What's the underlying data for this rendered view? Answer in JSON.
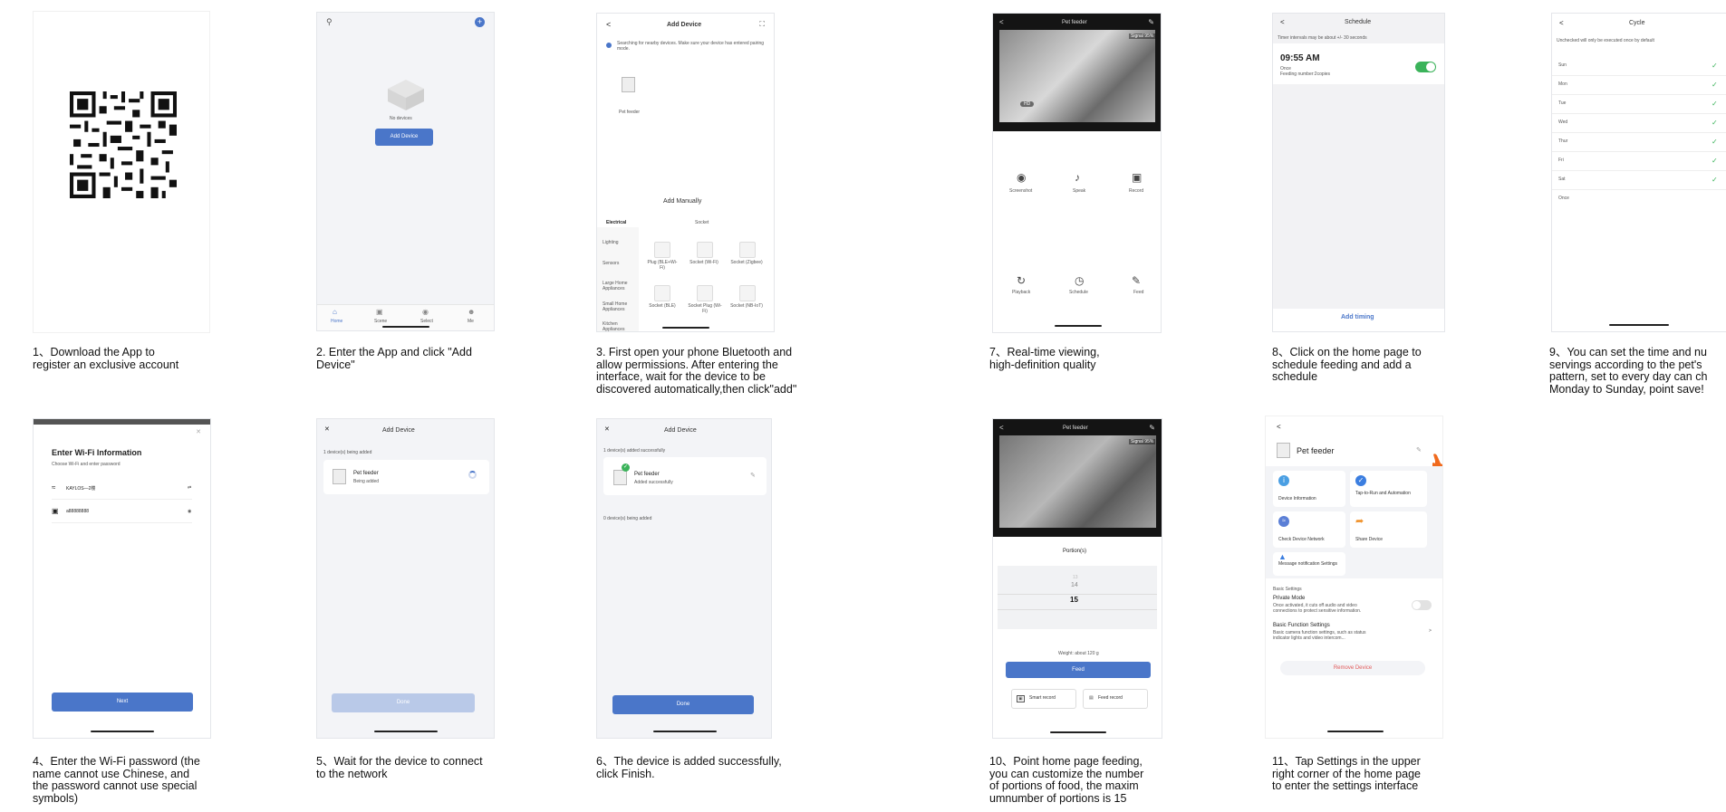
{
  "captions": {
    "c1": [
      "1、Download the App to",
      "register an exclusive account"
    ],
    "c2": [
      "2. Enter the App and click \"Add",
      "Device\""
    ],
    "c3": [
      "3. First open your phone Bluetooth and",
      "allow permissions. After entering the",
      "interface, wait for the device to be",
      "discovered automatically,then click\"add\""
    ],
    "c7": [
      "7、Real-time viewing,",
      "high-definition quality"
    ],
    "c8": [
      "8、Click on the home page to",
      "schedule feeding and add a",
      "schedule"
    ],
    "c9": [
      "9、You can set the time and nu",
      "servings according to the pet's",
      "pattern, set to every day can ch",
      "Monday to Sunday, point save!"
    ],
    "c4": [
      "4、Enter the Wi-Fi password (the",
      "name cannot use Chinese, and",
      "the password cannot use special",
      "symbols)"
    ],
    "c5": [
      "5、Wait for the device to connect",
      "to the network"
    ],
    "c6": [
      "6、The device is added successfully,",
      "click Finish."
    ],
    "c10": [
      "10、Point home page feeding,",
      "you can customize the number",
      "of portions of food, the maxim",
      "umnumber of portions is 15"
    ],
    "c11": [
      "11、Tap Settings in the upper",
      "right corner of the home page",
      "to enter the settings interface"
    ]
  },
  "s2": {
    "empty": "No devices",
    "add_button": "Add Device",
    "tabs": [
      "Home",
      "Scene",
      "Select",
      "Me"
    ]
  },
  "s3": {
    "title": "Add Device",
    "scan_text": "Searching for nearby devices. Make sure your device has entered pairing mode.",
    "found_device": "Pet feeder",
    "add_manually": "Add Manually",
    "tabs": [
      "Electrical",
      "Socket"
    ],
    "categories": [
      "Lighting",
      "Sensors",
      "Large Home Appliances",
      "Small Home Appliances",
      "Kitchen Appliances"
    ],
    "items": [
      "Plug (BLE+Wi-Fi)",
      "Socket (Wi-Fi)",
      "Socket (Zigbee)",
      "Socket (BLE)",
      "Socket Plug (Wi-Fi)",
      "Socket (NB-IoT)"
    ]
  },
  "s7": {
    "title": "Pet feeder",
    "badge": "Signal 95%",
    "hd": "HD",
    "controls": [
      "Screenshot",
      "Speak",
      "Record",
      "Playback",
      "Schedule",
      "Feed"
    ]
  },
  "s8": {
    "title": "Schedule",
    "note": "Timer intervals may be about +/- 30 seconds",
    "time": "09:55 AM",
    "sub1": "Once",
    "sub2": "Feeding number:2copies",
    "add_timing": "Add timing"
  },
  "s9": {
    "title": "Cycle",
    "note": "Unchecked will only be executed once by default",
    "days": [
      "Sun",
      "Mon",
      "Tue",
      "Wed",
      "Thur",
      "Fri",
      "Sat",
      "Once"
    ]
  },
  "s4": {
    "title": "Enter Wi-Fi Information",
    "subtitle": "Choose Wi-Fi and enter password",
    "ssid": "KAYLOS—2楼",
    "password": "a88888888",
    "next": "Next"
  },
  "s5": {
    "title": "Add Device",
    "status": "1 device(s) being added",
    "device": "Pet feeder",
    "device_status": "Being added",
    "done": "Done"
  },
  "s6": {
    "title": "Add Device",
    "status": "1 device(s) added successfully",
    "device": "Pet feeder",
    "device_status": "Added successfully",
    "pending": "0 device(s) being added",
    "done": "Done"
  },
  "s10": {
    "title": "Pet feeder",
    "badge": "Signal 95%",
    "portions_label": "Portion(s)",
    "picker": [
      "13",
      "14",
      "15"
    ],
    "weight": "Weight: about 120 g",
    "feed": "Feed",
    "smart_record": "Smart record",
    "feed_record": "Feed record"
  },
  "s11": {
    "device": "Pet feeder",
    "tiles": [
      "Device Information",
      "Tap-to-Run and Automation",
      "Check Device Network",
      "Share Device",
      "Message notification Settings"
    ],
    "section": "Basic Settings",
    "private_title": "Private Mode",
    "private_desc": "Once activated, it cuts off audio and video connections to protect sensitive information.",
    "basic_title": "Basic Function Settings",
    "basic_desc": "Basic camera function settings, such as status indicator lights and video intercom...",
    "remove": "Remove Device"
  },
  "colors": {
    "accent": "#4a76c9",
    "toggle_on": "#3bb35a",
    "check": "#3bb35a",
    "hand": "#f06a1e"
  }
}
